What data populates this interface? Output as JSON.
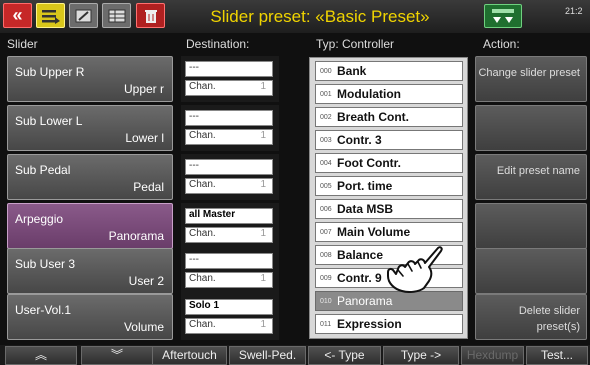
{
  "header": {
    "title": "Slider preset: «Basic Preset»",
    "clock": "21:2",
    "icons": [
      "back-icon",
      "menu-icon",
      "edit-icon",
      "table-icon",
      "trash-icon",
      "arrange-icon"
    ]
  },
  "columns": {
    "slider": "Slider",
    "destination": "Destination:",
    "typ": "Typ:  Controller",
    "action": "Action:"
  },
  "sliders": [
    {
      "name": "Sub Upper R",
      "sub": "Upper r",
      "dest_top": "---",
      "dest_bottom": "Chan.",
      "chan": "1"
    },
    {
      "name": "Sub Lower L",
      "sub": "Lower l",
      "dest_top": "---",
      "dest_bottom": "Chan.",
      "chan": "1"
    },
    {
      "name": "Sub Pedal",
      "sub": "Pedal",
      "dest_top": "---",
      "dest_bottom": "Chan.",
      "chan": "1"
    },
    {
      "name": "Arpeggio",
      "sub": "Panorama",
      "dest_top": "all Master",
      "dest_bottom": "Chan.",
      "chan": "1"
    },
    {
      "name": "Sub User 3",
      "sub": "User 2",
      "dest_top": "---",
      "dest_bottom": "Chan.",
      "chan": "1"
    },
    {
      "name": "User-Vol.1",
      "sub": "Volume",
      "dest_top": "Solo 1",
      "dest_bottom": "Chan.",
      "chan": "1"
    }
  ],
  "controllers": [
    {
      "num": "000",
      "label": "Bank"
    },
    {
      "num": "001",
      "label": "Modulation"
    },
    {
      "num": "002",
      "label": "Breath Cont."
    },
    {
      "num": "003",
      "label": "Contr. 3"
    },
    {
      "num": "004",
      "label": "Foot Contr."
    },
    {
      "num": "005",
      "label": "Port. time"
    },
    {
      "num": "006",
      "label": "Data MSB"
    },
    {
      "num": "007",
      "label": "Main Volume"
    },
    {
      "num": "008",
      "label": "Balance"
    },
    {
      "num": "009",
      "label": "Contr. 9"
    },
    {
      "num": "010",
      "label": "Panorama"
    },
    {
      "num": "011",
      "label": "Expression"
    }
  ],
  "actions": [
    {
      "label": "Change slider preset"
    },
    {
      "label": ""
    },
    {
      "label": "Edit preset name"
    },
    {
      "label": ""
    },
    {
      "label": ""
    },
    {
      "label": "Delete slider preset(s)"
    }
  ],
  "bottom": {
    "page_up": "≈",
    "page_down": "≈",
    "aftertouch": "Aftertouch",
    "swell": "Swell-Ped.",
    "type_prev": "<- Type",
    "type_next": "Type ->",
    "hexdump": "Hexdump",
    "test": "Test..."
  },
  "colors": {
    "title": "#f0d400",
    "active_slider": "#7a4b7a",
    "selected_controller": "#8a8a8a",
    "back_button": "#c62828",
    "menu_button": "#d9c71a"
  }
}
